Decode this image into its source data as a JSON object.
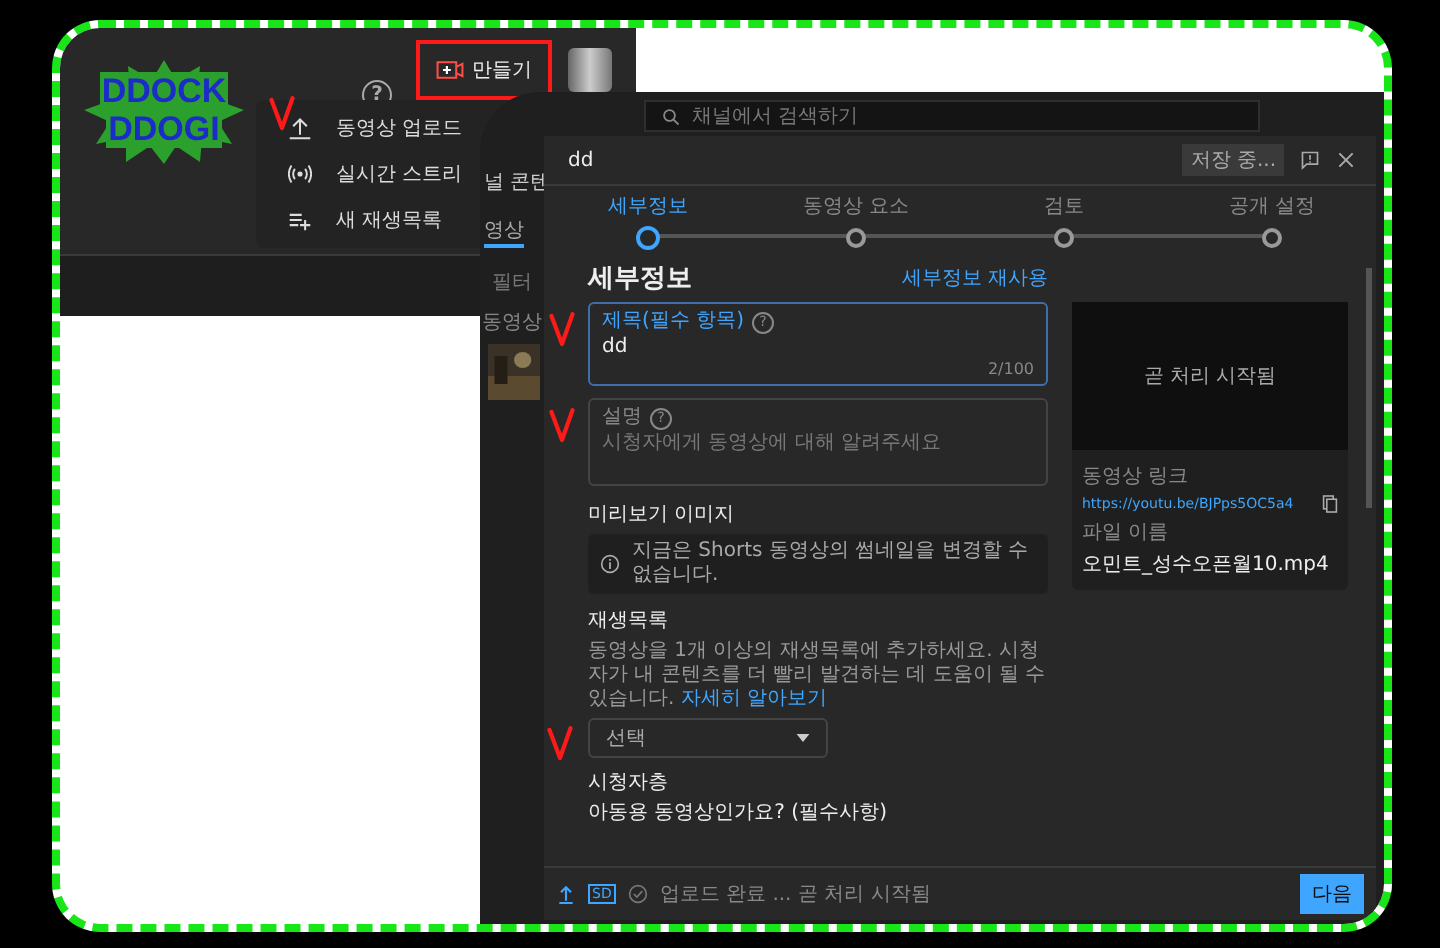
{
  "header": {
    "logo_lines": [
      "DDOCK",
      "DDOGI"
    ],
    "help": "?",
    "create_button": {
      "label": "만들기",
      "highlighted": true
    }
  },
  "create_menu": [
    {
      "label": "동영상 업로드",
      "kind": "upload"
    },
    {
      "label": "실시간 스트리",
      "kind": "live"
    },
    {
      "label": "새 재생목록",
      "kind": "playlist"
    }
  ],
  "studio": {
    "search_placeholder": "채널에서 검색하기",
    "heading": "널 콘텐",
    "tab": "영상",
    "filter": "필터",
    "column": "동영상"
  },
  "dialog": {
    "title": "dd",
    "save_status": "저장 중...",
    "steps": [
      {
        "label": "세부정보",
        "selected": true
      },
      {
        "label": "동영상 요소",
        "selected": false
      },
      {
        "label": "검토",
        "selected": false
      },
      {
        "label": "공개 설정",
        "selected": false
      }
    ],
    "heading": "세부정보",
    "reuse_link": "세부정보 재사용",
    "title_field": {
      "label": "제목(필수 항목)",
      "help": "?",
      "value": "dd",
      "counter": "2/100",
      "focused": true
    },
    "description_field": {
      "label": "설명",
      "help": "?",
      "placeholder": "시청자에게 동영상에 대해 알려주세요"
    },
    "thumbnail": {
      "heading": "미리보기 이미지",
      "notice": "지금은 Shorts 동영상의 썸네일을 변경할 수 없습니다."
    },
    "playlist": {
      "heading": "재생목록",
      "text": "동영상을 1개 이상의 재생목록에 추가하세요. 시청자가 내 콘텐츠를 더 빨리 발견하는 데 도움이 될 수 있습니다.",
      "link": "자세히 알아보기",
      "select": "선택"
    },
    "audience": {
      "heading": "시청자층",
      "question": "아동용 동영상인가요? (필수사항)"
    },
    "preview": {
      "status": "곧 처리 시작됨",
      "link_label": "동영상 링크",
      "link": "https://youtu.be/BJPps5OC5a4",
      "file_label": "파일 이름",
      "file_name": "오민트_성수오픈월10.mp4"
    },
    "footer": {
      "quality": "SD",
      "status": "업로드 완료 ... 곧 처리 시작됨",
      "next": "다음"
    }
  }
}
